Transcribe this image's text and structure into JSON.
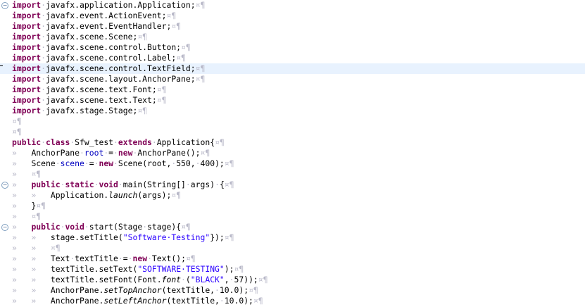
{
  "editor": {
    "lines": [
      {
        "fold": "⊖",
        "segs": [
          [
            "kw",
            "import"
          ],
          [
            "ws",
            "·"
          ],
          [
            "",
            "javafx.application.Application;"
          ],
          [
            "pil",
            "¤¶"
          ]
        ]
      },
      {
        "segs": [
          [
            "kw",
            "import"
          ],
          [
            "ws",
            "·"
          ],
          [
            "",
            "javafx.event.ActionEvent;"
          ],
          [
            "pil",
            "¤¶"
          ]
        ]
      },
      {
        "segs": [
          [
            "kw",
            "import"
          ],
          [
            "ws",
            "·"
          ],
          [
            "",
            "javafx.event.EventHandler;"
          ],
          [
            "pil",
            "¤¶"
          ]
        ]
      },
      {
        "segs": [
          [
            "kw",
            "import"
          ],
          [
            "ws",
            "·"
          ],
          [
            "",
            "javafx.scene.Scene;"
          ],
          [
            "pil",
            "¤¶"
          ]
        ]
      },
      {
        "segs": [
          [
            "kw",
            "import"
          ],
          [
            "ws",
            "·"
          ],
          [
            "",
            "javafx.scene.control.Button;"
          ],
          [
            "pil",
            "¤¶"
          ]
        ]
      },
      {
        "segs": [
          [
            "kw",
            "import"
          ],
          [
            "ws",
            "·"
          ],
          [
            "",
            "javafx.scene.control.Label;"
          ],
          [
            "pil",
            "¤¶"
          ]
        ]
      },
      {
        "current": true,
        "caret": true,
        "segs": [
          [
            "kw",
            "import"
          ],
          [
            "ws",
            "·"
          ],
          [
            "",
            "javafx.scene.control.TextField;"
          ],
          [
            "pil",
            "¤¶"
          ]
        ]
      },
      {
        "segs": [
          [
            "kw",
            "import"
          ],
          [
            "ws",
            "·"
          ],
          [
            "",
            "javafx.scene.layout.AnchorPane;"
          ],
          [
            "pil",
            "¤¶"
          ]
        ]
      },
      {
        "segs": [
          [
            "kw",
            "import"
          ],
          [
            "ws",
            "·"
          ],
          [
            "",
            "javafx.scene.text.Font;"
          ],
          [
            "pil",
            "¤¶"
          ]
        ]
      },
      {
        "segs": [
          [
            "kw",
            "import"
          ],
          [
            "ws",
            "·"
          ],
          [
            "",
            "javafx.scene.text.Text;"
          ],
          [
            "pil",
            "¤¶"
          ]
        ]
      },
      {
        "segs": [
          [
            "kw",
            "import"
          ],
          [
            "ws",
            "·"
          ],
          [
            "",
            "javafx.stage.Stage;"
          ],
          [
            "pil",
            "¤¶"
          ]
        ]
      },
      {
        "segs": [
          [
            "pil",
            "¤¶"
          ]
        ]
      },
      {
        "segs": [
          [
            "pil",
            "¤¶"
          ]
        ]
      },
      {
        "segs": [
          [
            "kw",
            "public"
          ],
          [
            "ws",
            "·"
          ],
          [
            "kw",
            "class"
          ],
          [
            "ws",
            "·"
          ],
          [
            "",
            "Sfw_test"
          ],
          [
            "ws",
            "·"
          ],
          [
            "kw",
            "extends"
          ],
          [
            "ws",
            "·"
          ],
          [
            "",
            "Application{"
          ],
          [
            "pil",
            "¤¶"
          ]
        ]
      },
      {
        "segs": [
          [
            "ws",
            "»   "
          ],
          [
            "",
            "AnchorPane"
          ],
          [
            "ws",
            "·"
          ],
          [
            "fld",
            "root"
          ],
          [
            "ws",
            "·"
          ],
          [
            "",
            "="
          ],
          [
            "ws",
            "·"
          ],
          [
            "kw",
            "new"
          ],
          [
            "ws",
            "·"
          ],
          [
            "",
            "AnchorPane();"
          ],
          [
            "pil",
            "¤¶"
          ]
        ]
      },
      {
        "segs": [
          [
            "ws",
            "»   "
          ],
          [
            "",
            "Scene"
          ],
          [
            "ws",
            "·"
          ],
          [
            "fld",
            "scene"
          ],
          [
            "ws",
            "·"
          ],
          [
            "",
            "="
          ],
          [
            "ws",
            "·"
          ],
          [
            "kw",
            "new"
          ],
          [
            "ws",
            "·"
          ],
          [
            "",
            "Scene(root,"
          ],
          [
            "ws",
            "·"
          ],
          [
            "",
            "550,"
          ],
          [
            "ws",
            "·"
          ],
          [
            "",
            "400);"
          ],
          [
            "pil",
            "¤¶"
          ]
        ]
      },
      {
        "segs": [
          [
            "ws",
            "»   "
          ],
          [
            "pil",
            "¤¶"
          ]
        ]
      },
      {
        "fold": "⊖",
        "segs": [
          [
            "ws",
            "»   "
          ],
          [
            "kw",
            "public"
          ],
          [
            "ws",
            "·"
          ],
          [
            "kw",
            "static"
          ],
          [
            "ws",
            "·"
          ],
          [
            "kw",
            "void"
          ],
          [
            "ws",
            "·"
          ],
          [
            "",
            "main(String[]"
          ],
          [
            "ws",
            "·"
          ],
          [
            "",
            "args)"
          ],
          [
            "ws",
            "·"
          ],
          [
            "",
            "{"
          ],
          [
            "pil",
            "¤¶"
          ]
        ]
      },
      {
        "segs": [
          [
            "ws",
            "»   »   "
          ],
          [
            "",
            "Application."
          ],
          [
            "it",
            "launch"
          ],
          [
            "",
            "(args);"
          ],
          [
            "pil",
            "¤¶"
          ]
        ]
      },
      {
        "segs": [
          [
            "ws",
            "»   "
          ],
          [
            "",
            "}"
          ],
          [
            "pil",
            "¤¶"
          ]
        ]
      },
      {
        "segs": [
          [
            "ws",
            "»   "
          ],
          [
            "pil",
            "¤¶"
          ]
        ]
      },
      {
        "fold": "⊖",
        "segs": [
          [
            "ws",
            "»   "
          ],
          [
            "kw",
            "public"
          ],
          [
            "ws",
            "·"
          ],
          [
            "kw",
            "void"
          ],
          [
            "ws",
            "·"
          ],
          [
            "",
            "start(Stage"
          ],
          [
            "ws",
            "·"
          ],
          [
            "",
            "stage){"
          ],
          [
            "pil",
            "¤¶"
          ]
        ]
      },
      {
        "segs": [
          [
            "ws",
            "»   »   "
          ],
          [
            "",
            "stage.setTitle("
          ],
          [
            "str",
            "\"Software·Testing\""
          ],
          [
            "",
            "});"
          ],
          [
            "pil",
            "¤¶"
          ]
        ]
      },
      {
        "segs": [
          [
            "ws",
            "»   »   "
          ],
          [
            "pil",
            "¤¶"
          ]
        ]
      },
      {
        "segs": [
          [
            "ws",
            "»   »   "
          ],
          [
            "",
            "Text"
          ],
          [
            "ws",
            "·"
          ],
          [
            "",
            "textTitle"
          ],
          [
            "ws",
            "·"
          ],
          [
            "",
            "="
          ],
          [
            "ws",
            "·"
          ],
          [
            "kw",
            "new"
          ],
          [
            "ws",
            "·"
          ],
          [
            "",
            "Text();"
          ],
          [
            "pil",
            "¤¶"
          ]
        ]
      },
      {
        "segs": [
          [
            "ws",
            "»   »   "
          ],
          [
            "",
            "textTitle.setText("
          ],
          [
            "str",
            "\"SOFTWARE·TESTING\""
          ],
          [
            "",
            ");"
          ],
          [
            "pil",
            "¤¶"
          ]
        ]
      },
      {
        "segs": [
          [
            "ws",
            "»   »   "
          ],
          [
            "",
            "textTitle.setFont(Font."
          ],
          [
            "it",
            "font"
          ],
          [
            "ws",
            "·"
          ],
          [
            "",
            "("
          ],
          [
            "str",
            "\"BLACK\""
          ],
          [
            "",
            ","
          ],
          [
            "ws",
            "·"
          ],
          [
            "",
            "57));"
          ],
          [
            "pil",
            "¤¶"
          ]
        ]
      },
      {
        "segs": [
          [
            "ws",
            "»   »   "
          ],
          [
            "",
            "AnchorPane."
          ],
          [
            "it",
            "setTopAnchor"
          ],
          [
            "",
            "(textTitle,"
          ],
          [
            "ws",
            "·"
          ],
          [
            "",
            "10.0);"
          ],
          [
            "pil",
            "¤¶"
          ]
        ]
      },
      {
        "segs": [
          [
            "ws",
            "»   »   "
          ],
          [
            "",
            "AnchorPane."
          ],
          [
            "it",
            "setLeftAnchor"
          ],
          [
            "",
            "(textTitle,"
          ],
          [
            "ws",
            "·"
          ],
          [
            "",
            "10.0);"
          ],
          [
            "pil",
            "¤¶"
          ]
        ]
      }
    ]
  }
}
